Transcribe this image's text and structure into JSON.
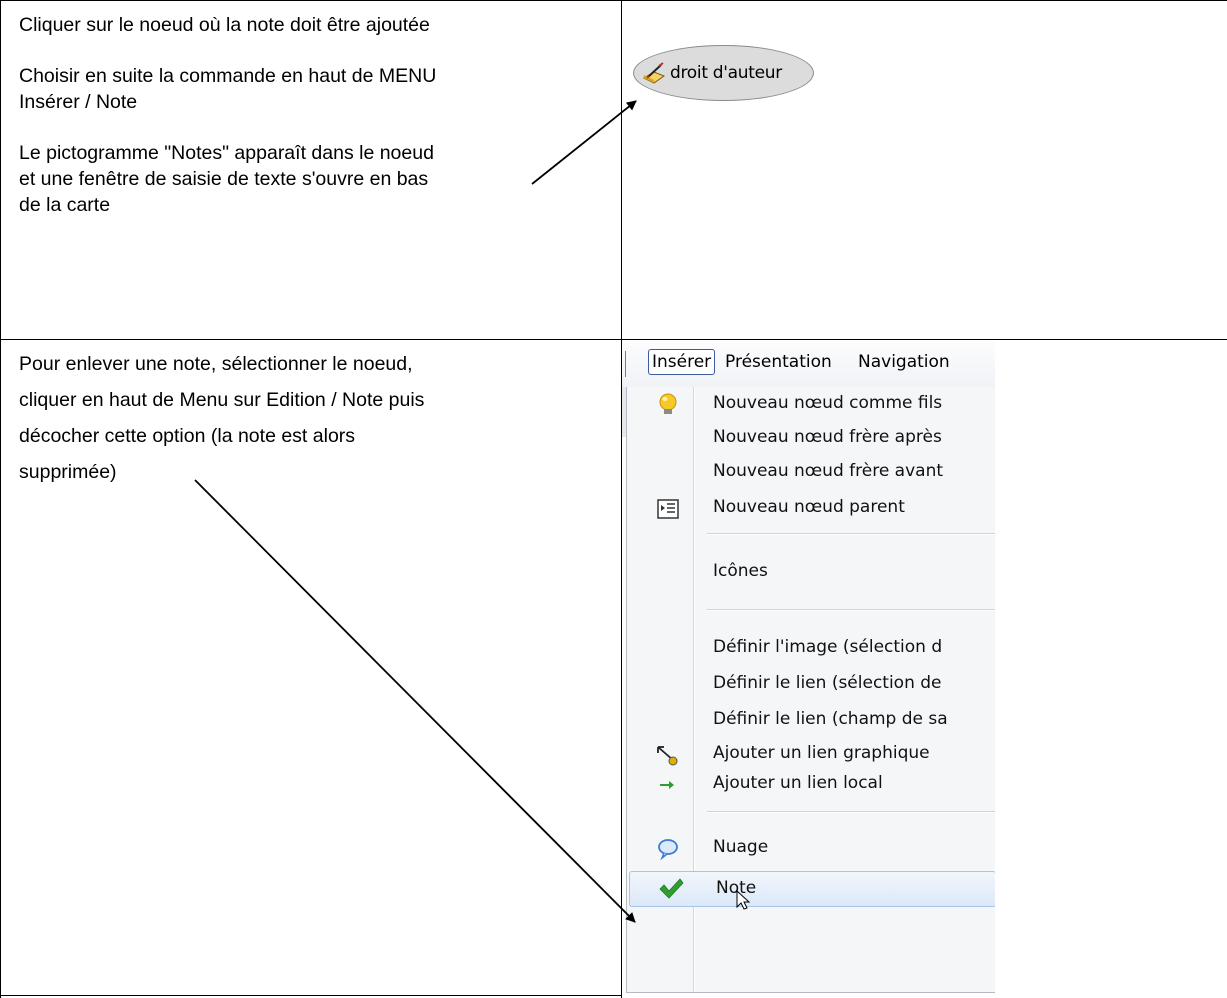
{
  "row1": {
    "paragraphs": [
      [
        "Cliquer sur le noeud où la note doit être ajoutée"
      ],
      [
        "Choisir en suite la commande en haut de MENU",
        "Insérer / Note"
      ],
      [
        "Le pictogramme \"Notes\" apparaît dans le noeud",
        "et une fenêtre de saisie de texte s'ouvre en bas",
        "de la carte"
      ]
    ],
    "node_label": "droit d'auteur"
  },
  "row2": {
    "lines": [
      "Pour enlever une note, sélectionner le noeud,",
      "cliquer en haut de Menu  sur Edition / Note puis",
      "décocher  cette option (la note est alors",
      "supprimée)"
    ]
  },
  "menubar": {
    "items": [
      "Insérer",
      "Présentation",
      "Navigation"
    ]
  },
  "menu": {
    "items": [
      {
        "label": "Nouveau nœud comme fils",
        "icon": "lightbulb-icon"
      },
      {
        "label": "Nouveau nœud frère après",
        "icon": ""
      },
      {
        "label": "Nouveau nœud frère avant",
        "icon": ""
      },
      {
        "label": "Nouveau nœud parent",
        "icon": "parent-node-icon"
      },
      {
        "label": "Icônes",
        "icon": ""
      },
      {
        "label": "Définir l'image (sélection d",
        "icon": ""
      },
      {
        "label": "Définir le lien (sélection de",
        "icon": ""
      },
      {
        "label": "Définir le lien (champ de sa",
        "icon": ""
      },
      {
        "label": "Ajouter un lien graphique",
        "icon": "graphic-link-icon"
      },
      {
        "label": "Ajouter un lien local",
        "icon": "green-arrow-icon"
      },
      {
        "label": "Nuage",
        "icon": "cloud-icon"
      },
      {
        "label": "Note",
        "icon": "checkmark-icon"
      }
    ]
  },
  "colors": {
    "grid": "#000000",
    "node_fill": "#dcdcdc",
    "menu_bg": "#f5f6f8",
    "highlight_border": "#a9c3ea",
    "check_green": "#2e9e2e"
  }
}
